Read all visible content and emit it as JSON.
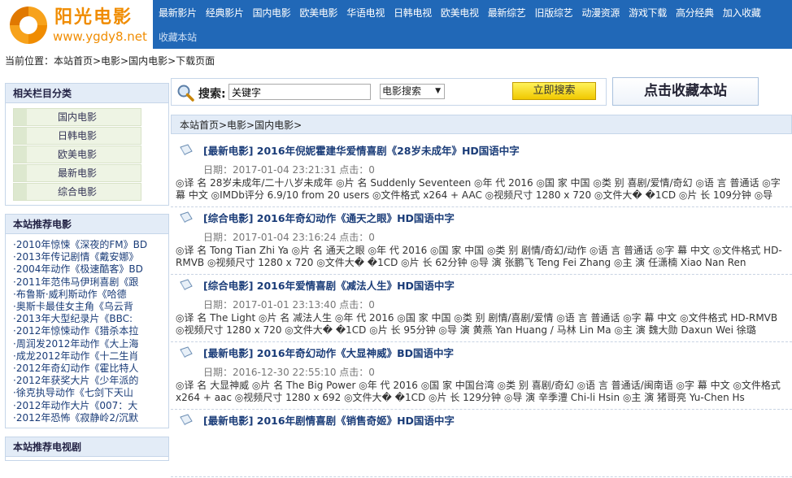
{
  "logo": {
    "title": "阳光电影",
    "url": "www.ygdy8.net"
  },
  "nav": {
    "row1": [
      "最新影片",
      "经典影片",
      "国内电影",
      "欧美电影",
      "华语电视",
      "日韩电视",
      "欧美电视",
      "最新综艺",
      "旧版综艺",
      "动漫资源",
      "游戏下载",
      "高分经典",
      "加入收藏"
    ],
    "row2": [
      "收藏本站"
    ]
  },
  "breadcrumb": "当前位置：本站首页>电影>国内电影>下载页面",
  "side": {
    "cat_title": "相关栏目分类",
    "cats": [
      "国内电影",
      "日韩电影",
      "欧美电影",
      "最新电影",
      "综合电影"
    ],
    "rec_title": "本站推荐电影",
    "recs": [
      "·2010年惊悚《深夜的FM》BD",
      "·2013年传记剧情《戴安娜》",
      "·2004年动作《极速酷客》BD",
      "·2011年范伟马伊琍喜剧《跟",
      "·布鲁斯·威利斯动作《哈德",
      "·奥斯卡最佳女主角《乌云背",
      "·2013年大型纪录片《BBC:",
      "·2012年惊悚动作《猎杀本拉",
      "·周润发2012年动作《大上海",
      "·成龙2012年动作《十二生肖",
      "·2012年奇幻动作《霍比特人",
      "·2012年获奖大片《少年派的",
      "·徐克执导动作《七剑下天山",
      "·2012年动作大片《007：大",
      "·2012年恐怖《寂静岭2/沉默"
    ],
    "rec2_title": "本站推荐电视剧"
  },
  "search": {
    "label": "搜索:",
    "value": "关键字",
    "select": "电影搜索",
    "button": "立即搜索"
  },
  "fav": "点击收藏本站",
  "main": {
    "crumb": "本站首页>电影>国内电影>",
    "items": [
      {
        "title": "[最新电影] 2016年倪妮霍建华爱情喜剧《28岁未成年》HD国语中字",
        "date": "日期：2017-01-04 23:21:31 点击：0",
        "desc": "◎译 名 28岁未成年/二十八岁未成年 ◎片 名 Suddenly Seventeen ◎年 代 2016 ◎国 家 中国 ◎类 别 喜剧/爱情/奇幻 ◎语 言 普通话 ◎字 幕 中文 ◎IMDb评分 6.9/10 from 20 users ◎文件格式 x264 + AAC ◎视频尺寸 1280 x 720 ◎文件大� �1CD ◎片 长 109分钟 ◎导"
      },
      {
        "title": "[综合电影] 2016年奇幻动作《通天之眼》HD国语中字",
        "date": "日期：2017-01-04 23:16:24 点击：0",
        "desc": "◎译 名 Tong Tian Zhi Ya ◎片 名 通天之眼 ◎年 代 2016 ◎国 家 中国 ◎类 别 剧情/奇幻/动作 ◎语 言 普通话 ◎字 幕 中文 ◎文件格式 HD-RMVB ◎视频尺寸 1280 x 720 ◎文件大� �1CD ◎片 长 62分钟 ◎导 演 张鹏飞 Teng Fei Zhang ◎主 演 任潇楠 Xiao Nan Ren"
      },
      {
        "title": "[综合电影] 2016年爱情喜剧《减法人生》HD国语中字",
        "date": "日期：2017-01-01 23:13:40 点击：0",
        "desc": "◎译 名 The Light ◎片 名 减法人生 ◎年 代 2016 ◎国 家 中国 ◎类 别 剧情/喜剧/爱情 ◎语 言 普通话 ◎字 幕 中文 ◎文件格式 HD-RMVB ◎视频尺寸 1280 x 720 ◎文件大� �1CD ◎片 长 95分钟 ◎导 演 黄燕 Yan Huang / 马林 Lin Ma ◎主 演 魏大勋 Daxun Wei 徐璐"
      },
      {
        "title": "[最新电影] 2016年奇幻动作《大显神威》BD国语中字",
        "date": "日期：2016-12-30 22:55:10 点击：0",
        "desc": "◎译 名 大显神威 ◎片 名 The Big Power ◎年 代 2016 ◎国 家 中国台湾 ◎类 别 喜剧/奇幻 ◎语 言 普通话/闽南语 ◎字 幕 中文 ◎文件格式 x264 + aac ◎视频尺寸 1280 x 692 ◎文件大� �1CD ◎片 长 129分钟 ◎导 演 辛季澧 Chi-li Hsin ◎主 演 猪哥亮 Yu-Chen Hs"
      },
      {
        "title": "[最新电影] 2016年剧情喜剧《销售奇姬》HD国语中字",
        "date": "",
        "desc": ""
      }
    ]
  }
}
